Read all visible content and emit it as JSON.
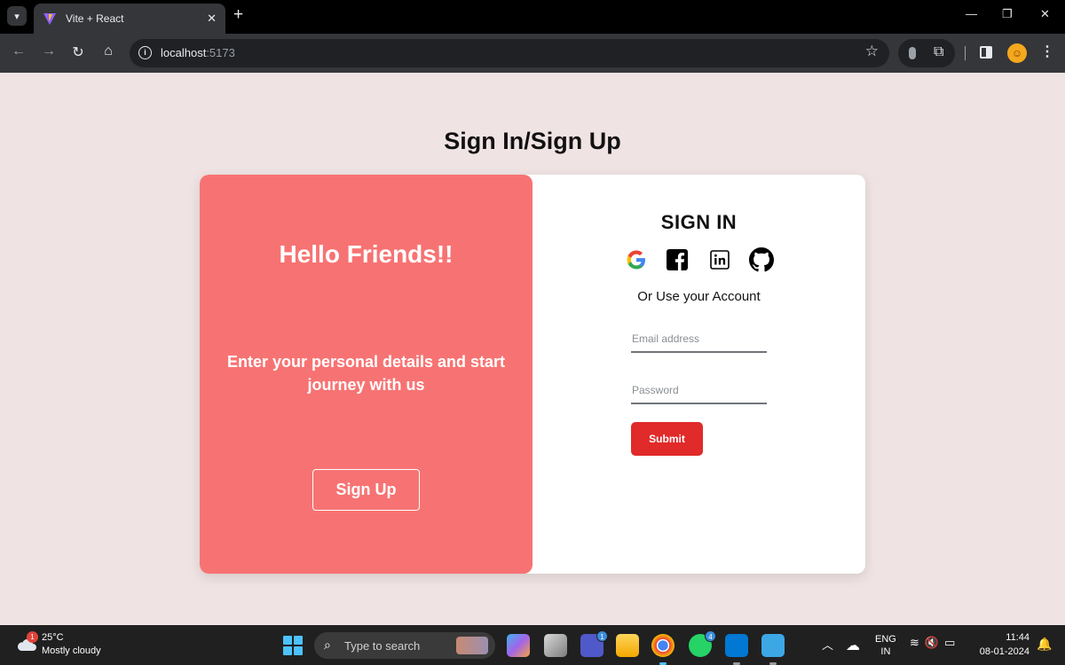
{
  "browser": {
    "tab_title": "Vite + React",
    "tab_close": "✕",
    "new_tab": "+",
    "url_host": "localhost",
    "url_port": ":5173",
    "window_controls": [
      "—",
      "❐",
      "✕"
    ]
  },
  "page": {
    "heading": "Sign In/Sign Up",
    "left_panel": {
      "greeting": "Hello Friends!!",
      "description": "Enter your personal details and start journey with us",
      "signup_label": "Sign Up"
    },
    "right_panel": {
      "title": "SIGN IN",
      "social_icons": [
        "google-icon",
        "facebook-icon",
        "linkedin-icon",
        "github-icon"
      ],
      "alt_text": "Or Use your Account",
      "email_placeholder": "Email address",
      "password_placeholder": "Password",
      "submit_label": "Submit"
    },
    "colors": {
      "background": "#f0e3e4",
      "left_panel": "#f77373",
      "submit_button": "#e12a2a"
    }
  },
  "taskbar": {
    "weather_badge": "1",
    "temperature": "25°C",
    "weather": "Mostly cloudy",
    "search_placeholder": "Type to search",
    "teams_badge": "1",
    "whatsapp_badge": "4",
    "lang_top": "ENG",
    "lang_bottom": "IN",
    "time": "11:44",
    "date": "08-01-2024"
  }
}
